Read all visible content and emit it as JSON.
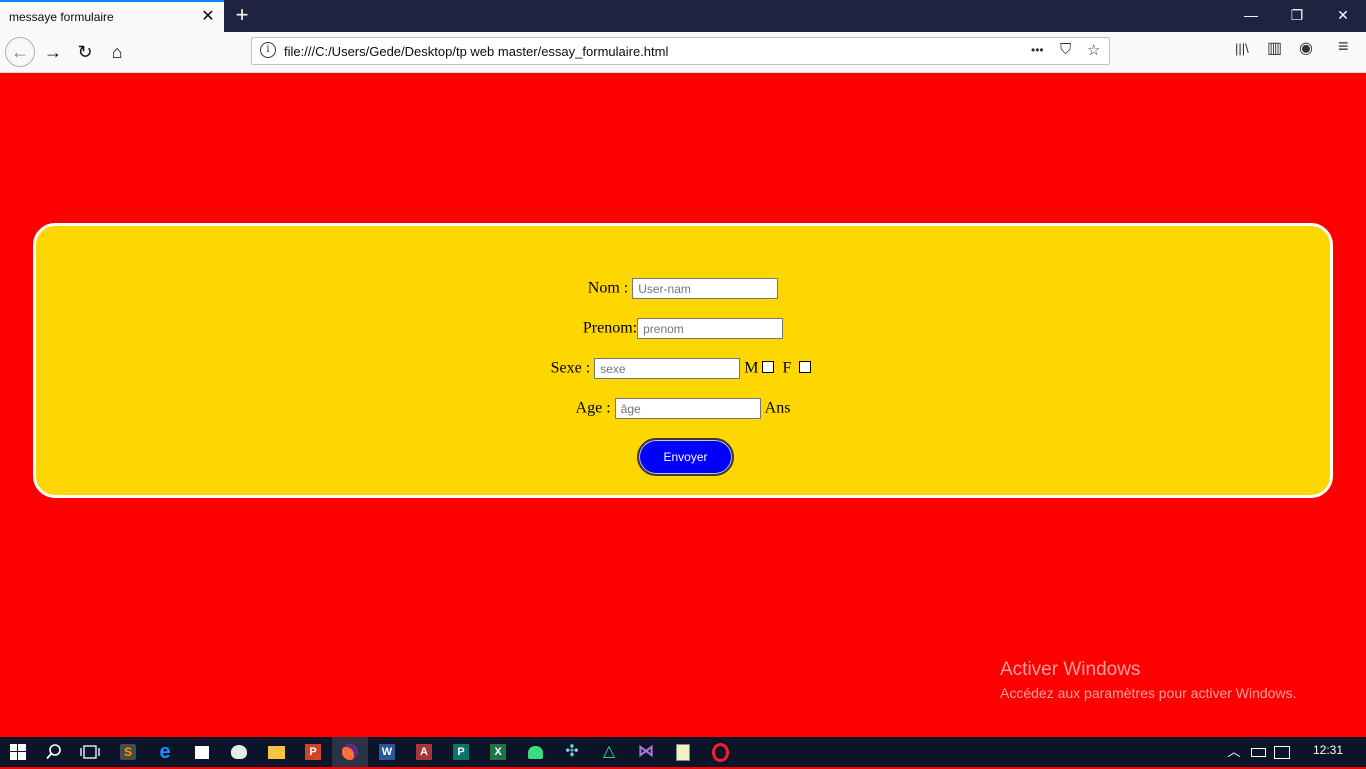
{
  "browser": {
    "tab_title": "messaye formulaire",
    "tab_close": "✕",
    "new_tab": "+",
    "url": "file:///C:/Users/Gede/Desktop/tp web master/essay_formulaire.html",
    "window_controls": {
      "minimize": "—",
      "restore": "❐",
      "close": "✕"
    },
    "nav": {
      "back": "←",
      "forward": "→",
      "reload": "↻",
      "home": "⌂"
    },
    "url_actions": {
      "more": "•••",
      "pocket": "⛉",
      "bookmark": "☆"
    },
    "tools": {
      "library": "|||\\",
      "sidebar": "▥",
      "account": "◉",
      "menu": "≡"
    }
  },
  "form": {
    "nom_label": "Nom :",
    "nom_placeholder": "User-nam",
    "prenom_label": "Prenom:",
    "prenom_placeholder": "prenom",
    "sexe_label": "Sexe :",
    "sexe_placeholder": "sexe",
    "sexe_m": "M",
    "sexe_f": "F",
    "age_label": "Age :",
    "age_placeholder": "âge",
    "age_unit": "Ans",
    "submit": "Envoyer"
  },
  "colors": {
    "page_bg": "#ff0000",
    "form_bg": "#ffd700",
    "submit_bg": "#0000ff"
  },
  "watermark": {
    "title": "Activer Windows",
    "subtitle": "Accédez aux paramètres pour activer Windows."
  },
  "taskbar": {
    "icons": [
      "windows-start-icon",
      "search-icon",
      "task-view-icon",
      "sublime-text-icon",
      "edge-icon",
      "store-icon",
      "paint-icon",
      "file-explorer-icon",
      "powerpoint-icon",
      "firefox-icon",
      "word-icon",
      "access-icon",
      "publisher-icon",
      "excel-icon",
      "android-icon",
      "network-icon",
      "android-studio-icon",
      "visual-studio-icon",
      "notepad-icon",
      "opera-icon"
    ],
    "time": "12:31"
  }
}
